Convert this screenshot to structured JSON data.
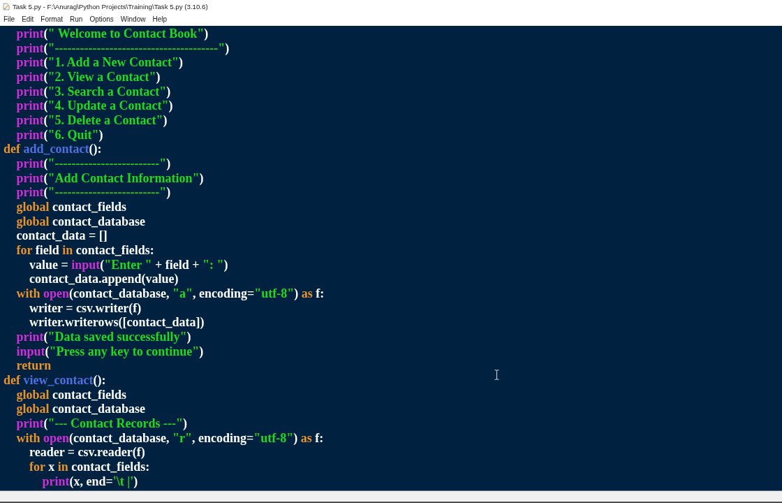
{
  "window": {
    "title": "Task 5.py - F:\\Anurag\\Python Projects\\Training\\Task 5.py (3.10.6)"
  },
  "menu": [
    "File",
    "Edit",
    "Format",
    "Run",
    "Options",
    "Window",
    "Help"
  ],
  "editor": {
    "lines": [
      {
        "children": [
          {
            "tokens": [
              {
                "kind": "builtin",
                "text": "print"
              },
              {
                "kind": "plain",
                "text": "("
              },
              {
                "kind": "string",
                "text": "\" Welcome to Contact Book\""
              },
              {
                "kind": "plain",
                "text": ")"
              }
            ]
          },
          {
            "tokens": [
              {
                "kind": "builtin",
                "text": "print"
              },
              {
                "kind": "plain",
                "text": "("
              },
              {
                "kind": "string",
                "text": "\"---------------------------------------\""
              },
              {
                "kind": "plain",
                "text": ")"
              }
            ]
          },
          {
            "tokens": [
              {
                "kind": "builtin",
                "text": "print"
              },
              {
                "kind": "plain",
                "text": "("
              },
              {
                "kind": "string",
                "text": "\"1. Add a New Contact\""
              },
              {
                "kind": "plain",
                "text": ")"
              }
            ]
          },
          {
            "tokens": [
              {
                "kind": "builtin",
                "text": "print"
              },
              {
                "kind": "plain",
                "text": "("
              },
              {
                "kind": "string",
                "text": "\"2. View a Contact\""
              },
              {
                "kind": "plain",
                "text": ")"
              }
            ]
          },
          {
            "tokens": [
              {
                "kind": "builtin",
                "text": "print"
              },
              {
                "kind": "plain",
                "text": "("
              },
              {
                "kind": "string",
                "text": "\"3. Search a Contact\""
              },
              {
                "kind": "plain",
                "text": ")"
              }
            ]
          },
          {
            "tokens": [
              {
                "kind": "builtin",
                "text": "print"
              },
              {
                "kind": "plain",
                "text": "("
              },
              {
                "kind": "string",
                "text": "\"4. Update a Contact\""
              },
              {
                "kind": "plain",
                "text": ")"
              }
            ]
          },
          {
            "tokens": [
              {
                "kind": "builtin",
                "text": "print"
              },
              {
                "kind": "plain",
                "text": "("
              },
              {
                "kind": "string",
                "text": "\"5. Delete a Contact\""
              },
              {
                "kind": "plain",
                "text": ")"
              }
            ]
          },
          {
            "tokens": [
              {
                "kind": "builtin",
                "text": "print"
              },
              {
                "kind": "plain",
                "text": "("
              },
              {
                "kind": "string",
                "text": "\"6. Quit\""
              },
              {
                "kind": "plain",
                "text": ")"
              }
            ]
          }
        ]
      },
      {
        "tokens": [
          {
            "kind": "keyword",
            "text": "def"
          },
          {
            "kind": "function",
            "text": " add_contact"
          },
          {
            "kind": "plain",
            "text": "():"
          }
        ],
        "children": [
          {
            "tokens": [
              {
                "kind": "builtin",
                "text": "print"
              },
              {
                "kind": "plain",
                "text": "("
              },
              {
                "kind": "string",
                "text": "\"-------------------------\""
              },
              {
                "kind": "plain",
                "text": ")"
              }
            ]
          },
          {
            "tokens": [
              {
                "kind": "builtin",
                "text": "print"
              },
              {
                "kind": "plain",
                "text": "("
              },
              {
                "kind": "string",
                "text": "\"Add Contact Information\""
              },
              {
                "kind": "plain",
                "text": ")"
              }
            ]
          },
          {
            "tokens": [
              {
                "kind": "builtin",
                "text": "print"
              },
              {
                "kind": "plain",
                "text": "("
              },
              {
                "kind": "string",
                "text": "\"-------------------------\""
              },
              {
                "kind": "plain",
                "text": ")"
              }
            ]
          },
          {
            "tokens": [
              {
                "kind": "keyword",
                "text": "global"
              },
              {
                "kind": "plain",
                "text": " contact_fields"
              }
            ]
          },
          {
            "tokens": [
              {
                "kind": "keyword",
                "text": "global"
              },
              {
                "kind": "plain",
                "text": " contact_database"
              }
            ]
          },
          {
            "tokens": [
              {
                "kind": "plain",
                "text": "contact_data = []"
              }
            ]
          },
          {
            "tokens": [
              {
                "kind": "keyword",
                "text": "for"
              },
              {
                "kind": "plain",
                "text": " field "
              },
              {
                "kind": "keyword",
                "text": "in"
              },
              {
                "kind": "plain",
                "text": " contact_fields:"
              }
            ],
            "children": [
              {
                "tokens": [
                  {
                    "kind": "plain",
                    "text": "value = "
                  },
                  {
                    "kind": "builtin",
                    "text": "input"
                  },
                  {
                    "kind": "plain",
                    "text": "("
                  },
                  {
                    "kind": "string",
                    "text": "\"Enter \""
                  },
                  {
                    "kind": "plain",
                    "text": " + field + "
                  },
                  {
                    "kind": "string",
                    "text": "\": \""
                  },
                  {
                    "kind": "plain",
                    "text": ")"
                  }
                ]
              },
              {
                "tokens": [
                  {
                    "kind": "plain",
                    "text": "contact_data.append(value)"
                  }
                ]
              }
            ]
          },
          {
            "tokens": [
              {
                "kind": "keyword",
                "text": "with "
              },
              {
                "kind": "builtin",
                "text": "open"
              },
              {
                "kind": "plain",
                "text": "(contact_database, "
              },
              {
                "kind": "string",
                "text": "\"a\""
              },
              {
                "kind": "plain",
                "text": ", encoding="
              },
              {
                "kind": "string",
                "text": "\"utf-8\""
              },
              {
                "kind": "plain",
                "text": ") "
              },
              {
                "kind": "keyword",
                "text": "as"
              },
              {
                "kind": "plain",
                "text": " f:"
              }
            ],
            "children": [
              {
                "tokens": [
                  {
                    "kind": "plain",
                    "text": "writer = csv.writer(f)"
                  }
                ]
              },
              {
                "tokens": [
                  {
                    "kind": "plain",
                    "text": "writer.writerows([contact_data])"
                  }
                ]
              }
            ]
          },
          {
            "tokens": [
              {
                "kind": "builtin",
                "text": "print"
              },
              {
                "kind": "plain",
                "text": "("
              },
              {
                "kind": "string",
                "text": "\"Data saved successfully\""
              },
              {
                "kind": "plain",
                "text": ")"
              }
            ]
          },
          {
            "tokens": [
              {
                "kind": "builtin",
                "text": "input"
              },
              {
                "kind": "plain",
                "text": "("
              },
              {
                "kind": "string",
                "text": "\"Press any key to continue\""
              },
              {
                "kind": "plain",
                "text": ")"
              }
            ]
          },
          {
            "tokens": [
              {
                "kind": "keyword",
                "text": "return"
              }
            ]
          }
        ]
      },
      {
        "tokens": [
          {
            "kind": "keyword",
            "text": "def"
          },
          {
            "kind": "function",
            "text": " view_contact"
          },
          {
            "kind": "plain",
            "text": "():"
          }
        ],
        "children": [
          {
            "tokens": [
              {
                "kind": "keyword",
                "text": "global"
              },
              {
                "kind": "plain",
                "text": " contact_fields"
              }
            ]
          },
          {
            "tokens": [
              {
                "kind": "keyword",
                "text": "global"
              },
              {
                "kind": "plain",
                "text": " contact_database"
              }
            ]
          },
          {
            "tokens": [
              {
                "kind": "builtin",
                "text": "print"
              },
              {
                "kind": "plain",
                "text": "("
              },
              {
                "kind": "string",
                "text": "\"--- Contact Records ---\""
              },
              {
                "kind": "plain",
                "text": ")"
              }
            ]
          },
          {
            "tokens": [
              {
                "kind": "keyword",
                "text": "with "
              },
              {
                "kind": "builtin",
                "text": "open"
              },
              {
                "kind": "plain",
                "text": "(contact_database, "
              },
              {
                "kind": "string",
                "text": "\"r\""
              },
              {
                "kind": "plain",
                "text": ", encoding="
              },
              {
                "kind": "string",
                "text": "\"utf-8\""
              },
              {
                "kind": "plain",
                "text": ") "
              },
              {
                "kind": "keyword",
                "text": "as"
              },
              {
                "kind": "plain",
                "text": " f:"
              }
            ],
            "children": [
              {
                "tokens": [
                  {
                    "kind": "plain",
                    "text": "reader = csv.reader(f)"
                  }
                ]
              },
              {
                "tokens": [
                  {
                    "kind": "keyword",
                    "text": "for"
                  },
                  {
                    "kind": "plain",
                    "text": " x "
                  },
                  {
                    "kind": "keyword",
                    "text": "in"
                  },
                  {
                    "kind": "plain",
                    "text": " contact_fields:"
                  }
                ],
                "children": [
                  {
                    "tokens": [
                      {
                        "kind": "builtin",
                        "text": "print"
                      },
                      {
                        "kind": "plain",
                        "text": "(x, end="
                      },
                      {
                        "kind": "string",
                        "text": "'\\t |'"
                      },
                      {
                        "kind": "plain",
                        "text": ")"
                      }
                    ]
                  }
                ]
              }
            ]
          }
        ]
      }
    ]
  }
}
